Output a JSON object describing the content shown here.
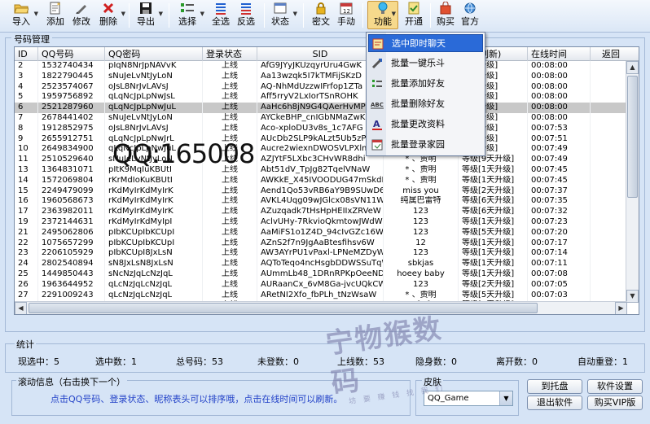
{
  "toolbar": {
    "import": "导入",
    "add": "添加",
    "edit": "修改",
    "delete": "删除",
    "export": "导出",
    "select": "选择",
    "select_all": "全选",
    "invert": "反选",
    "status": "状态",
    "password": "密文",
    "manual": "手动",
    "functions": "功能",
    "open": "开通",
    "buy": "购买",
    "official": "官方"
  },
  "main_group": {
    "title": "号码管理"
  },
  "table": {
    "columns": [
      "ID",
      "QQ号码",
      "QQ密码",
      "登录状态",
      "SID",
      "",
      "点击刷新)",
      "在线时间",
      "返回"
    ],
    "rows": [
      [
        "2",
        "1532740434",
        "pIqN8NrJpNAVvK",
        "上线",
        "AfG9JYyJKUzqyrUru4GwK",
        "",
        "[5天升级]",
        "00:08:00"
      ],
      [
        "3",
        "1822790445",
        "sNuJeLvNtJyLoN",
        "上线",
        "Aa13wzqk5I7kTMFijSKzD",
        "",
        "[5天升级]",
        "00:08:00"
      ],
      [
        "4",
        "2523574067",
        "oJsL8NrJvLAVsJ",
        "上线",
        "AQ-NhMdUzzwIFrfop1ZTa",
        "",
        "[9天升级]",
        "00:08:00"
      ],
      [
        "5",
        "1959756892",
        "qLqNcJpLpNwJsL",
        "上线",
        "Aff5rryV2LxIorTSnROHK",
        "",
        "[5天升级]",
        "00:08:00"
      ],
      [
        "6",
        "2521287960",
        "qLqNcJpLpNwJuL",
        "上线",
        "AaHc6h8jN9G4QAerHvMPM",
        "",
        "[1天升级]",
        "00:08:00"
      ],
      [
        "7",
        "2678441402",
        "sNuJeLvNtJyLoN",
        "上线",
        "AYCkeBHP_cnIGbNMaZwKE",
        "",
        "[7天升级]",
        "00:08:00"
      ],
      [
        "8",
        "1912852975",
        "oJsL8NrJvLAVsJ",
        "上线",
        "Aco-xploDU3v8s_1c7AFG",
        "",
        "[2天升级]",
        "00:07:53"
      ],
      [
        "9",
        "2655912751",
        "qLqNcJpLpNwJrL",
        "上线",
        "AUcDb2SLP9kALzt5Ub5zP",
        "",
        "[5天升级]",
        "00:07:51"
      ],
      [
        "10",
        "2649834900",
        "qLqNcJpLpNwJuL",
        "上线",
        "Aucre2wiexnDWOSVLPXlm",
        "",
        "[2天升级]",
        "00:07:49"
      ],
      [
        "11",
        "2510529640",
        "sNuJeLvNtJyLoN",
        "上线",
        "AZJYtF5LXbc3CHvWR8dhi",
        "* 、贾明",
        "等级[9天升级]",
        "00:07:49"
      ],
      [
        "13",
        "1364831071",
        "pItK9MqIuKBUtI",
        "上线",
        "Abt51dV_TpJg82TqelVNaW",
        "* 、贾明",
        "等级[1天升级]",
        "00:07:45"
      ],
      [
        "14",
        "1572069804",
        "rKrMdIoKuKBUtI",
        "上线",
        "AWKkE_X45IVOODUG47mSkdKW",
        "* 、贾明",
        "等级[1天升级]",
        "00:07:45"
      ],
      [
        "15",
        "2249479099",
        "rKdMyIrKdMyIrK",
        "上线",
        "Aend1Qo53vRB6aY9B9SUwD6W",
        "miss you",
        "等级[2天升级]",
        "00:07:37"
      ],
      [
        "16",
        "1960568673",
        "rKdMyIrKdMyIrK",
        "上线",
        "AVKL4Uqg09wJGlcx08sVN11W",
        "纯属巴雷特",
        "等级[6天升级]",
        "00:07:35"
      ],
      [
        "17",
        "2363982011",
        "rKdMyIrKdMyIrK",
        "上线",
        "AZuzqadk7tHsHpHEIIxZRVeW",
        "123",
        "等级[6天升级]",
        "00:07:32"
      ],
      [
        "19",
        "2372144631",
        "rKdMyIrKdMyIpI",
        "上线",
        "AclvUHy-7RkvioQkmtowJWdW",
        "123",
        "等级[1天升级]",
        "00:07:23"
      ],
      [
        "21",
        "2495062806",
        "pIbKCUpIbKCUpI",
        "上线",
        "AaMiFS1o1Z4D_94cIvGZc16W",
        "123",
        "等级[5天升级]",
        "00:07:20"
      ],
      [
        "22",
        "1075657299",
        "pIbKCUpIbKCUpI",
        "上线",
        "AZnS2f7n9JgAaBtesfihsv6W",
        "12",
        "等级[1天升级]",
        "00:07:17"
      ],
      [
        "23",
        "2206105929",
        "pIbKCUpI8JxLsN",
        "上线",
        "AW3AYrPU1vPaxl-LPNeMZDyW",
        "123",
        "等级[1天升级]",
        "00:07:14"
      ],
      [
        "24",
        "2802540894",
        "sN8JxLsN8JxLsN",
        "上线",
        "AQToTeqo4ncHsgbDDWSSuTqW",
        "sbkjas",
        "等级[1天升级]",
        "00:07:11"
      ],
      [
        "25",
        "1449850443",
        "sNcNzJqLcNzJqL",
        "上线",
        "AUmmLb48_1DRnRPKpOeeNDCW",
        "hoeey baby",
        "等级[1天升级]",
        "00:07:08"
      ],
      [
        "26",
        "1963644952",
        "qLcNzJqLcNzJqL",
        "上线",
        "AURaanCx_6vM8Ga-jvcUQkCW",
        "123",
        "等级[2天升级]",
        "00:07:05"
      ],
      [
        "27",
        "2291009243",
        "qLcNzJqLcNzJqL",
        "上线",
        "ARetNI2Xfo_fbPLh_tNzWsaW",
        "* 、贾明",
        "等级[5天升级]",
        "00:07:03"
      ],
      [
        "28",
        "2682609509",
        "qLcNzJqLcNzJqL",
        "上线",
        "AUx1zApoK7JpMIcqI12YnomW",
        "cf cf",
        "等级[2天升级]",
        "00:07:01"
      ]
    ],
    "selected_row": 4
  },
  "watermark": "QQ:165008",
  "stamp": {
    "big": "宁物猴数码",
    "small": "坊 要 赚 钱 找 我 们"
  },
  "stats": {
    "title": "统计",
    "current": "现选中：5",
    "selected": "选中数：1",
    "total": "总号码：53",
    "not_logged": "未登数：0",
    "online": "上线数：53",
    "hidden": "隐身数：0",
    "leave": "离开数：0",
    "auto_relogin": "自动重登：1"
  },
  "scroll_info": {
    "title": "滚动信息（右击换下一个）",
    "text": "点击QQ号码、登录状态、昵称表头可以排序哦，点击在线时间可以刷新。"
  },
  "skin": {
    "title": "皮肤",
    "value": "QQ_Game"
  },
  "buttons": {
    "to_tray": "到托盘",
    "settings": "软件设置",
    "exit": "退出软件",
    "buy_vip": "购买VIP版"
  },
  "menu": {
    "items": [
      {
        "label": "选中即时聊天",
        "icon": "chat-icon"
      },
      {
        "label": "批量一键乐斗",
        "icon": "fight-icon"
      },
      {
        "label": "批量添加好友",
        "icon": "add-friend-icon"
      },
      {
        "label": "批量删除好友",
        "icon": "delete-friend-icon"
      },
      {
        "label": "批量更改资料",
        "icon": "edit-profile-icon"
      },
      {
        "label": "批量登录家园",
        "icon": "home-login-icon"
      }
    ],
    "active_index": 0
  },
  "colors": {
    "accent": "#2a6ad8",
    "selected_row": "#c8c8c8",
    "info_text": "#2443c8"
  }
}
